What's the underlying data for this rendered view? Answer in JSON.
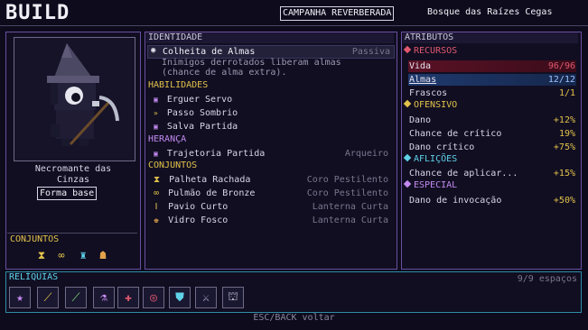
{
  "header": {
    "title": "BUILD",
    "mode": "CAMPANHA REVERBERADA",
    "location": "Bosque das Raízes Cegas"
  },
  "character": {
    "name": "Necromante das Cinzas",
    "form_button": "Forma base",
    "sets_title": "CONJUNTOS"
  },
  "identity": {
    "heading": "IDENTIDADE",
    "passive_name": "Colheita de Almas",
    "passive_tag": "Passiva",
    "passive_desc_1": "Inimigos derrotados liberam almas",
    "passive_desc_2": "(chance de alma extra)."
  },
  "abilities": {
    "heading": "HABILIDADES",
    "items": [
      "Erguer Servo",
      "Passo Sombrio",
      "Salva Partida"
    ]
  },
  "heritage": {
    "heading": "HERANÇA",
    "name": "Trajetoria Partida",
    "source": "Arqueiro"
  },
  "sets": {
    "heading": "CONJUNTOS",
    "items": [
      {
        "name": "Palheta Rachada",
        "set": "Coro Pestilento"
      },
      {
        "name": "Pulmão de Bronze",
        "set": "Coro Pestilento"
      },
      {
        "name": "Pavio Curto",
        "set": "Lanterna Curta"
      },
      {
        "name": "Vidro Fosco",
        "set": "Lanterna Curta"
      }
    ]
  },
  "attributes": {
    "heading": "ATRIBUTOS",
    "resources_heading": "RECURSOS",
    "life_label": "Vida",
    "life_value": "96/96",
    "souls_label": "Almas",
    "souls_value": "12/12",
    "flasks_label": "Frascos",
    "flasks_value": "1/1",
    "offense_heading": "OFENSIVO",
    "damage_label": "Dano",
    "damage_value": "+12%",
    "crit_chance_label": "Chance de crítico",
    "crit_chance_value": "19%",
    "crit_damage_label": "Dano crítico",
    "crit_damage_value": "+75%",
    "afflictions_heading": "AFLIÇÕES",
    "apply_chance_label": "Chance de aplicar...",
    "apply_chance_value": "+15%",
    "special_heading": "ESPECIAL",
    "summon_label": "Dano de invocação",
    "summon_value": "+50%"
  },
  "relics": {
    "heading": "RELÍQUIAS",
    "slots_text": "9/9 espaços",
    "icons": [
      "star-icon",
      "dagger-icon",
      "dagger-green-icon",
      "flask-icon",
      "cross-icon",
      "target-icon",
      "shield-icon",
      "sword-icon",
      "altar-icon"
    ]
  },
  "footer": {
    "hint": "ESC/BACK voltar"
  },
  "colors": {
    "gold": "#e2c24a",
    "purple": "#c38af0",
    "cyan": "#5fd2e8",
    "red": "#e0586e",
    "border_purple": "#6b4fa0"
  }
}
